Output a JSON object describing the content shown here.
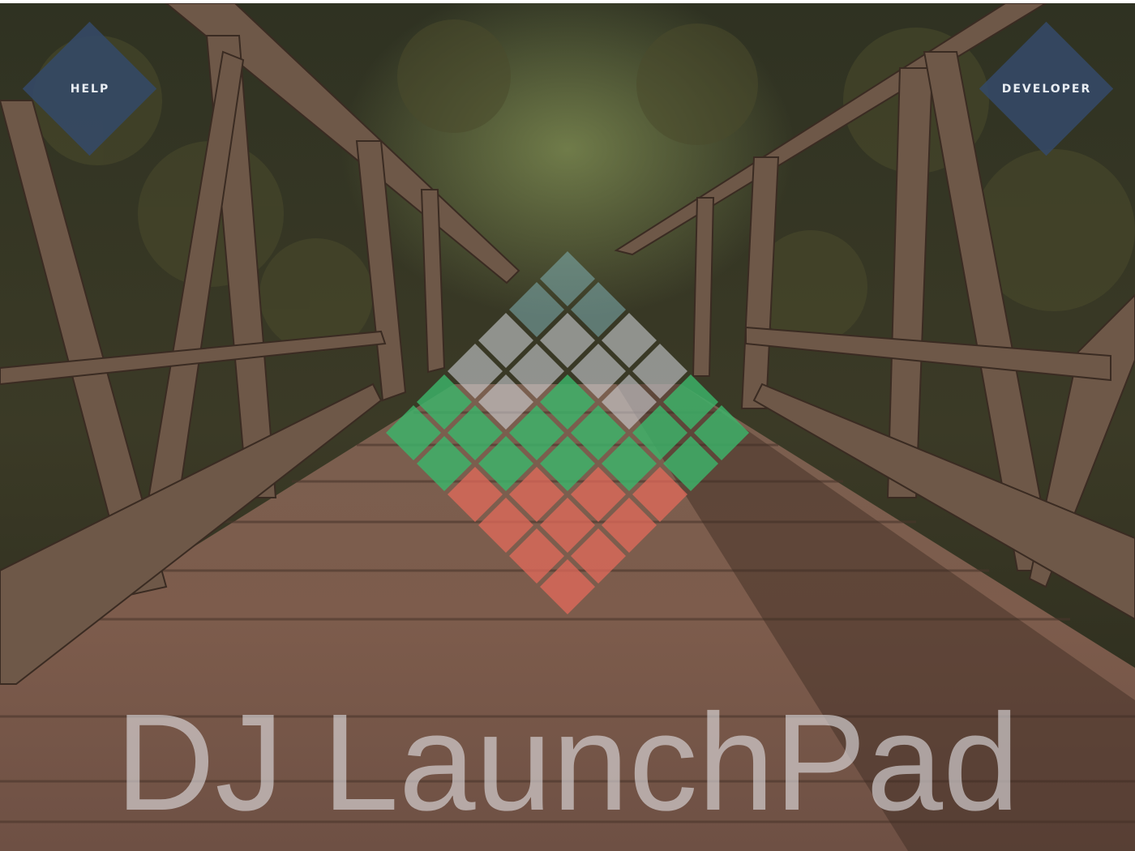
{
  "nav": {
    "help_label": "HELP",
    "developer_label": "DEVELOPER"
  },
  "app": {
    "title": "DJ LaunchPad"
  },
  "background": {
    "subject": "wooden-footbridge-photo"
  },
  "colors": {
    "button_bg": "#344968",
    "pad_green": "#3cb56a",
    "pad_red": "#e86b5c",
    "pad_white": "#d9dde4",
    "pad_teal": "#7fb0b4"
  },
  "logo_pads": {
    "rows": [
      [
        "teal"
      ],
      [
        "teal",
        "teal"
      ],
      [
        "white",
        "white",
        "white"
      ],
      [
        "white",
        "white",
        "white",
        "white"
      ],
      [
        "green",
        "white",
        "green",
        "white",
        "green"
      ],
      [
        "green",
        "green",
        "green",
        "green",
        "green",
        "green"
      ],
      [
        "green",
        "green",
        "green",
        "green",
        "green"
      ],
      [
        "red",
        "red",
        "red",
        "red"
      ],
      [
        "red",
        "red",
        "red"
      ],
      [
        "red",
        "red"
      ],
      [
        "red"
      ]
    ]
  }
}
